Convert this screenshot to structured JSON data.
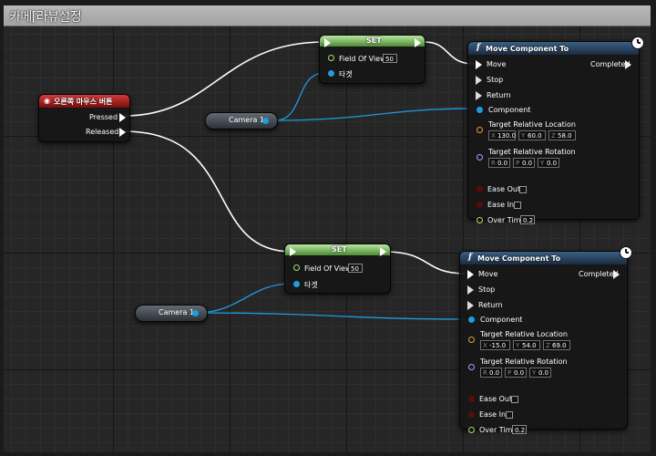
{
  "window": {
    "title": "카메[라뷰설정"
  },
  "colors": {
    "exec": "#ffffff",
    "object": "#1f9be0",
    "float": "#a6e06b",
    "vector": "#e0a03a",
    "rotator": "#9aa7ff",
    "bool": "#5a0c0c"
  },
  "event_node": {
    "title": "오른쪽 마우스 버튼",
    "pins": {
      "pressed": "Pressed",
      "released": "Released"
    }
  },
  "set_nodes": [
    {
      "title": "SET",
      "fov_label": "Field Of View",
      "fov_value": "50",
      "target_label": "타겟"
    },
    {
      "title": "SET",
      "fov_label": "Field Of View",
      "fov_value": "50",
      "target_label": "타겟"
    }
  ],
  "camera_nodes": [
    {
      "label": "Camera 1"
    },
    {
      "label": "Camera 1"
    }
  ],
  "move_nodes": [
    {
      "title": "Move Component To",
      "pins": {
        "move": "Move",
        "stop": "Stop",
        "return": "Return",
        "completed": "Completed",
        "component": "Component",
        "location": "Target Relative Location",
        "rotation": "Target Relative Rotation",
        "ease_out": "Ease Out",
        "ease_in": "Ease In",
        "over_time": "Over Time"
      },
      "location": {
        "x_label": "X",
        "x": "130.0",
        "y_label": "Y",
        "y": "60.0",
        "z_label": "Z",
        "z": "58.0"
      },
      "rotation": {
        "r_label": "R",
        "r": "0.0",
        "p_label": "P",
        "p": "0.0",
        "y_label": "Y",
        "y": "0.0"
      },
      "over_time_value": "0.2"
    },
    {
      "title": "Move Component To",
      "pins": {
        "move": "Move",
        "stop": "Stop",
        "return": "Return",
        "completed": "Completed",
        "component": "Component",
        "location": "Target Relative Location",
        "rotation": "Target Relative Rotation",
        "ease_out": "Ease Out",
        "ease_in": "Ease In",
        "over_time": "Over Time"
      },
      "location": {
        "x_label": "X",
        "x": "-15.0",
        "y_label": "Y",
        "y": "54.0",
        "z_label": "Z",
        "z": "69.0"
      },
      "rotation": {
        "r_label": "R",
        "r": "0.0",
        "p_label": "P",
        "p": "0.0",
        "y_label": "Y",
        "y": "0.0"
      },
      "over_time_value": "0.2"
    }
  ]
}
